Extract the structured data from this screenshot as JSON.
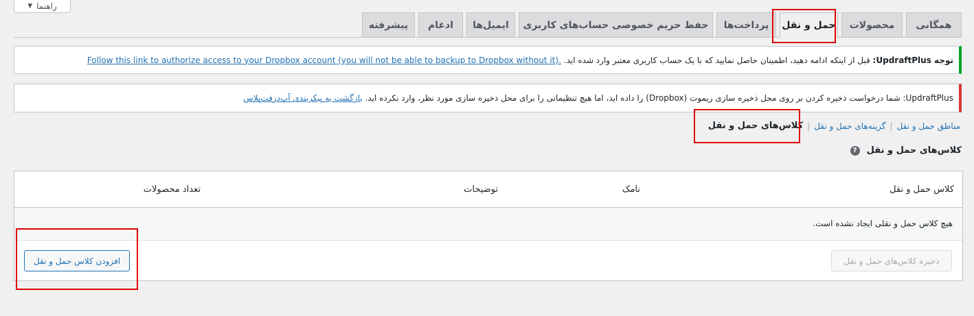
{
  "help": {
    "label": "راهنما",
    "arrow": "▼"
  },
  "tabs": [
    {
      "label": "همگانی",
      "active": false
    },
    {
      "label": "محصولات",
      "active": false
    },
    {
      "label": "حمل و نقل",
      "active": true
    },
    {
      "label": "پرداخت‌ها",
      "active": false
    },
    {
      "label": "حفظ حریم خصوصی حساب‌های کاربری",
      "active": false
    },
    {
      "label": "ایمیل‌ها",
      "active": false
    },
    {
      "label": "ادغام",
      "active": false
    },
    {
      "label": "پیشرفته",
      "active": false
    }
  ],
  "notices": {
    "warning": {
      "strong": "توجه UpdraftPlus:",
      "text": "قبل از اینکه ادامه دهید، اطمینان حاصل نمایید که با یک حساب کاربری معتبر وارد شده اید.",
      "link": "Follow this link to authorize access to your Dropbox account (you will not be able to backup to Dropbox without it)."
    },
    "error": {
      "strong": "UpdraftPlus:",
      "text": "شما درخواست ذخیره کردن بر روی محل ذخیره سازی ریموت (Dropbox) را داده اید، اما هیچ تنظیماتی را برای محل ذخیره سازی مورد نظر، وارد نکرده اید.",
      "link": "بازگشت به پیکربندی آپ‌درفت‌پلاس"
    }
  },
  "subnav": {
    "zones": "مناطق حمل و نقل",
    "options": "گزینه‌های حمل و نقل",
    "classes": "کلاس‌های حمل و نقل",
    "sep": "|"
  },
  "section": {
    "title": "کلاس‌های حمل و نقل",
    "help_icon": "?"
  },
  "table": {
    "columns": [
      "کلاس حمل و نقل",
      "نامک",
      "توضیحات",
      "تعداد محصولات"
    ],
    "empty": "هیچ کلاس حمل و نقلی ایجاد نشده است."
  },
  "buttons": {
    "save": "ذخیره کلاس‌های حمل و نقل",
    "add": "افزودن کلاس حمل و نقل"
  },
  "colors": {
    "accent": "#2271b1",
    "highlight": "#e00000",
    "success": "#00a32a",
    "error": "#d63638"
  }
}
